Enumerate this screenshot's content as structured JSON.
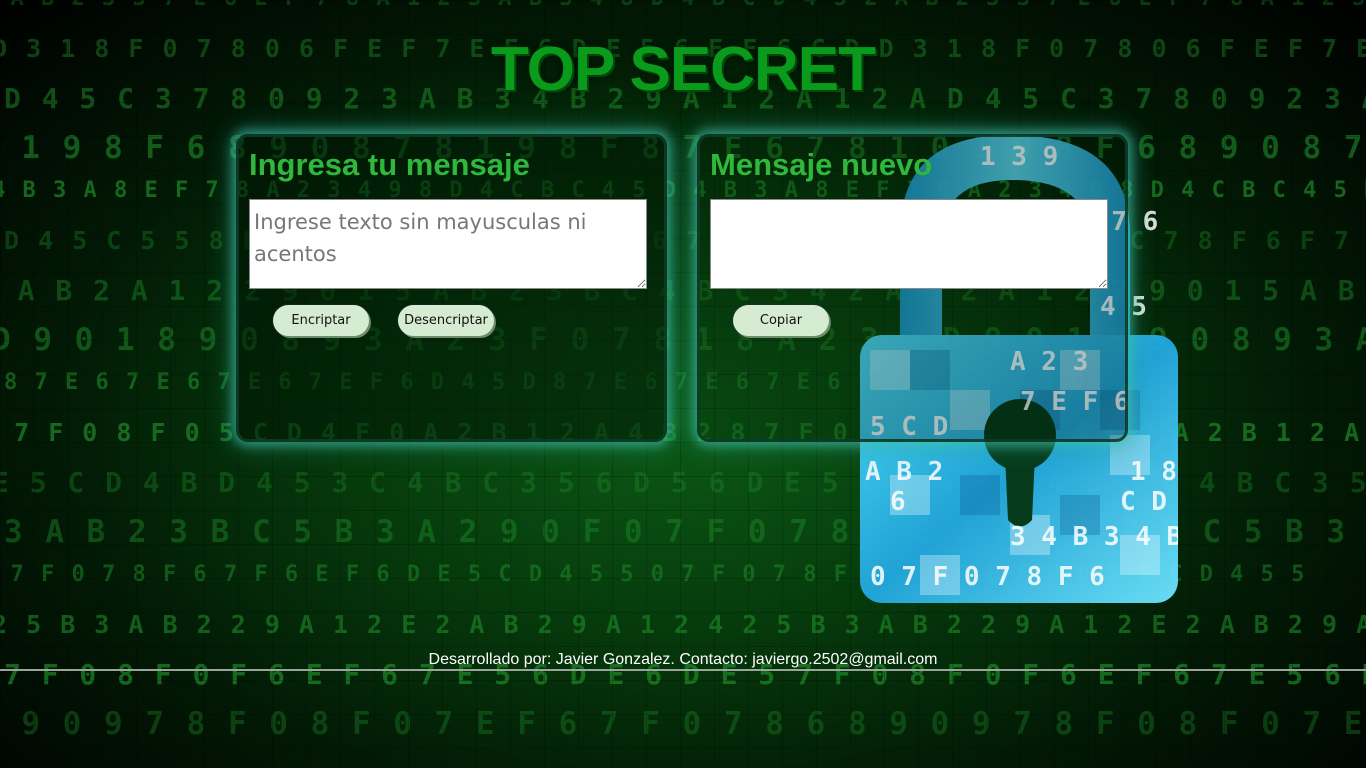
{
  "header": {
    "title": "TOP SECRET"
  },
  "input_panel": {
    "heading": "Ingresa tu mensaje",
    "textarea_value": "",
    "textarea_placeholder": "Ingrese texto sin mayusculas ni acentos",
    "encrypt_label": "Encriptar",
    "decrypt_label": "Desencriptar"
  },
  "output_panel": {
    "heading": "Mensaje nuevo",
    "textarea_value": "",
    "copy_label": "Copiar"
  },
  "footer": {
    "text": "Desarrollado por: Javier Gonzalez. Contacto: javiergo.2502@gmail.com"
  },
  "background": {
    "rows": [
      "2 A B 2 3 3 7 E 6 E F 7 8 A 1 2 3 A B 3 4 8 D 4 B C D 4 5",
      "D 3 1 8 F 0 7 8 0 6 F E F 7 E F 6 D E 5 6 E F 6 C D",
      "D 4 5 C 3 7 8 0 9 2 3 A B 3 4 B 2 9 A 1 2 A 1 2 A",
      "0 1 9 8 F 6 8 9 0 8 7 8 1 9 8 F 8 7 E 6 7 8 1",
      "4 B 3 A 8 E F 7 8 A 2 3 4 9 8 D 4 C B C 4 5 D",
      "D 4 5 C 5 5 8 E 5 D C 7 8 F 6 F 7 8 F 6 7 E F",
      "2 A B 2 A 1 2 2 9 0 1 5 A B 2 3 B C 4 B C 3 4",
      "D 9 0 1 8 9 0 8 9 3 A 2 3 F 0 7 8 1 8 A 2 3 9",
      "8 7 E 6 7 E 6 7 E 6 7 E F 6 D 4 5 D",
      "8 7 F 0 8 F 0 5 C D 4 F 0 A 2 B 1 2 A 4 B 2",
      "E 5 C D 4 B D 4 5 3 C 4 B C 3 5 6 D 5 6 D",
      "3 A B 2 3 B C 5 B 3 A 2 9 0 F 0 7 F 0 7 8 F 6",
      "0 7 F 0 7 8 F 6 7 F 6 E F 6 D E 5 C D 4 5 5",
      "2 5 B 3 A B 2 2 9 A 1 2 E 2 A B 2 9 A 1 2 4",
      "7 F 0 8 F 0 F 6 E F 6 7 E 5 6 D E 6 D E 5",
      "8 9 0 9 7 8 F 0 8 F 0 7 E F 6 7 F 0 7 8 6"
    ],
    "lock_glyphs": [
      "1 3 9",
      "8 7 6",
      "4 5",
      "A 2 3",
      "7 E F 6",
      "5 C D",
      "A B 2",
      "1 8",
      "6",
      "C D 4",
      "3 4 B 3 4 B 2 3 A",
      "0 7 F 0 7 8 F 6"
    ]
  },
  "colors": {
    "title_green": "#0a9b1c",
    "heading_green": "#2fb83c",
    "button_bg": "#d6ecd2",
    "panel_glow": "#46c8b4",
    "lock_blue": "#26c8ee"
  }
}
